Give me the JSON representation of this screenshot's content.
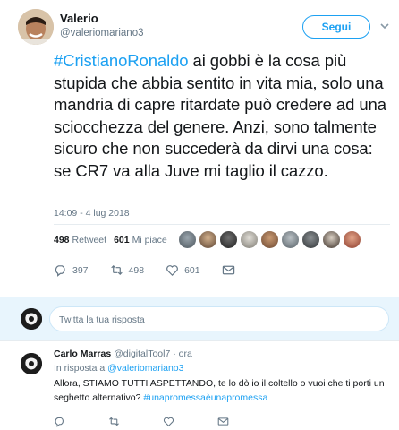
{
  "tweet": {
    "author_name": "Valerio",
    "author_handle": "@valeriomariano3",
    "follow_label": "Segui",
    "hashtag": "#CristianoRonaldo",
    "text_rest": " ai gobbi è la cosa più stupida che abbia sentito in vita mia, solo una mandria di capre ritardate può credere ad una sciocchezza del genere. Anzi, sono talmente sicuro che non succederà da dirvi una cosa: se CR7 va alla Juve mi taglio il cazzo.",
    "timestamp": "14:09 - 4 lug 2018",
    "retweet_count": "498",
    "retweet_label": "Retweet",
    "like_count": "601",
    "like_label": "Mi piace",
    "replies_action_count": "397",
    "retweets_action_count": "498",
    "likes_action_count": "601"
  },
  "reply_box": {
    "placeholder": "Twitta la tua risposta"
  },
  "reply": {
    "author_name": "Carlo Marras",
    "author_handle": "@digitalTool7",
    "time": "· ora",
    "in_reply_prefix": "In risposta a ",
    "in_reply_handle": "@valeriomariano3",
    "text": "Allora, STIAMO TUTTI ASPETTANDO, te lo dò io il coltello o vuoi che ti porti un seghetto alternativo? ",
    "hashtag": "#unapromessaèunapromessa"
  },
  "colors": {
    "accent": "#1da1f2",
    "text": "#14171a",
    "muted": "#657786",
    "reply_bg": "#e8f5fd"
  },
  "icons": [
    "chevron-down-icon",
    "reply-icon",
    "retweet-icon",
    "heart-icon",
    "mail-icon"
  ]
}
